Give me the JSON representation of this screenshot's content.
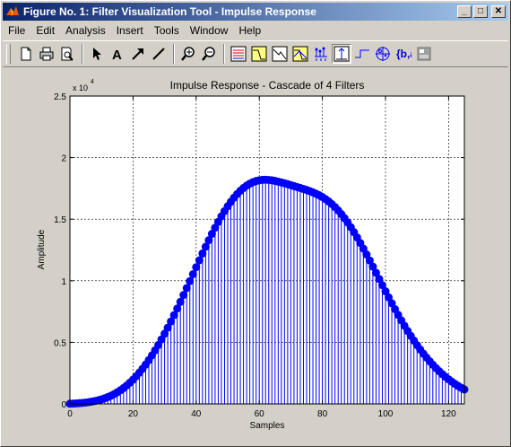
{
  "window": {
    "title": "Figure No. 1: Filter Visualization Tool - Impulse Response",
    "minimize_glyph": "_",
    "maximize_glyph": "□",
    "close_glyph": "✕"
  },
  "menu": [
    "File",
    "Edit",
    "Analysis",
    "Insert",
    "Tools",
    "Window",
    "Help"
  ],
  "toolbar": {
    "groups": [
      [
        "new-file-icon",
        "print-icon",
        "print-preview-icon"
      ],
      [
        "select-arrow-icon",
        "insert-text-icon",
        "insert-arrow-icon",
        "insert-line-icon"
      ],
      [
        "zoom-in-icon",
        "zoom-out-icon"
      ],
      [
        "filter-specs-icon",
        "magnitude-response-icon",
        "phase-response-icon",
        "magnitude-phase-icon",
        "group-delay-icon",
        "impulse-response-icon",
        "step-response-icon",
        "pole-zero-icon",
        "filter-coefficients-icon",
        "filter-info-icon"
      ]
    ],
    "pressed": "impulse-response-icon"
  },
  "chart_data": {
    "type": "stem",
    "title": "Impulse Response - Cascade of 4 Filters",
    "xlabel": "Samples",
    "ylabel": "Amplitude",
    "y_exponent_label": "x 10",
    "y_exponent": "4",
    "xlim": [
      0,
      125
    ],
    "ylim": [
      0,
      2.5
    ],
    "xticks": [
      "0",
      "20",
      "40",
      "60",
      "80",
      "100",
      "120"
    ],
    "yticks": [
      "0",
      "0.5",
      "1",
      "1.5",
      "2",
      "2.5"
    ],
    "xtick_values": [
      0,
      20,
      40,
      60,
      80,
      100,
      120
    ],
    "ytick_values": [
      0,
      0.5,
      1,
      1.5,
      2,
      2.5
    ],
    "grid": true,
    "color": "#0000ff",
    "x_start": 0,
    "values": [
      0.0017,
      0.0029,
      0.0043,
      0.0061,
      0.0083,
      0.0111,
      0.0146,
      0.0188,
      0.0238,
      0.0299,
      0.0371,
      0.0456,
      0.0554,
      0.0667,
      0.0796,
      0.0943,
      0.1108,
      0.1293,
      0.1498,
      0.1725,
      0.1973,
      0.2244,
      0.2538,
      0.2855,
      0.3195,
      0.3558,
      0.3943,
      0.4351,
      0.478,
      0.523,
      0.5699,
      0.6187,
      0.6691,
      0.7211,
      0.7744,
      0.8289,
      0.8843,
      0.9403,
      0.9968,
      1.0535,
      1.11,
      1.1662,
      1.2217,
      1.2762,
      1.3293,
      1.3809,
      1.4306,
      1.4781,
      1.5232,
      1.5656,
      1.6052,
      1.6416,
      1.6748,
      1.7046,
      1.7309,
      1.7536,
      1.7728,
      1.7885,
      1.8008,
      1.8099,
      1.8159,
      1.8191,
      1.8199,
      1.8186,
      1.8155,
      1.811,
      1.8053,
      1.7989,
      1.7918,
      1.7845,
      1.7769,
      1.7692,
      1.7614,
      1.7536,
      1.7455,
      1.7371,
      1.728,
      1.7181,
      1.7069,
      1.6942,
      1.6797,
      1.6631,
      1.6441,
      1.6226,
      1.5984,
      1.5713,
      1.5414,
      1.5087,
      1.4732,
      1.4352,
      1.3947,
      1.352,
      1.3073,
      1.2609,
      1.2132,
      1.1644,
      1.1148,
      1.0647,
      1.0145,
      0.9643,
      0.9145,
      0.8653,
      0.8169,
      0.7695,
      0.7233,
      0.6784,
      0.6349,
      0.5929,
      0.5526,
      0.5139,
      0.4769,
      0.4416,
      0.4081,
      0.3763,
      0.3462,
      0.3178,
      0.291,
      0.2659,
      0.2423,
      0.2202,
      0.1997,
      0.1805,
      0.1627,
      0.1463,
      0.1311,
      0.1171
    ]
  }
}
